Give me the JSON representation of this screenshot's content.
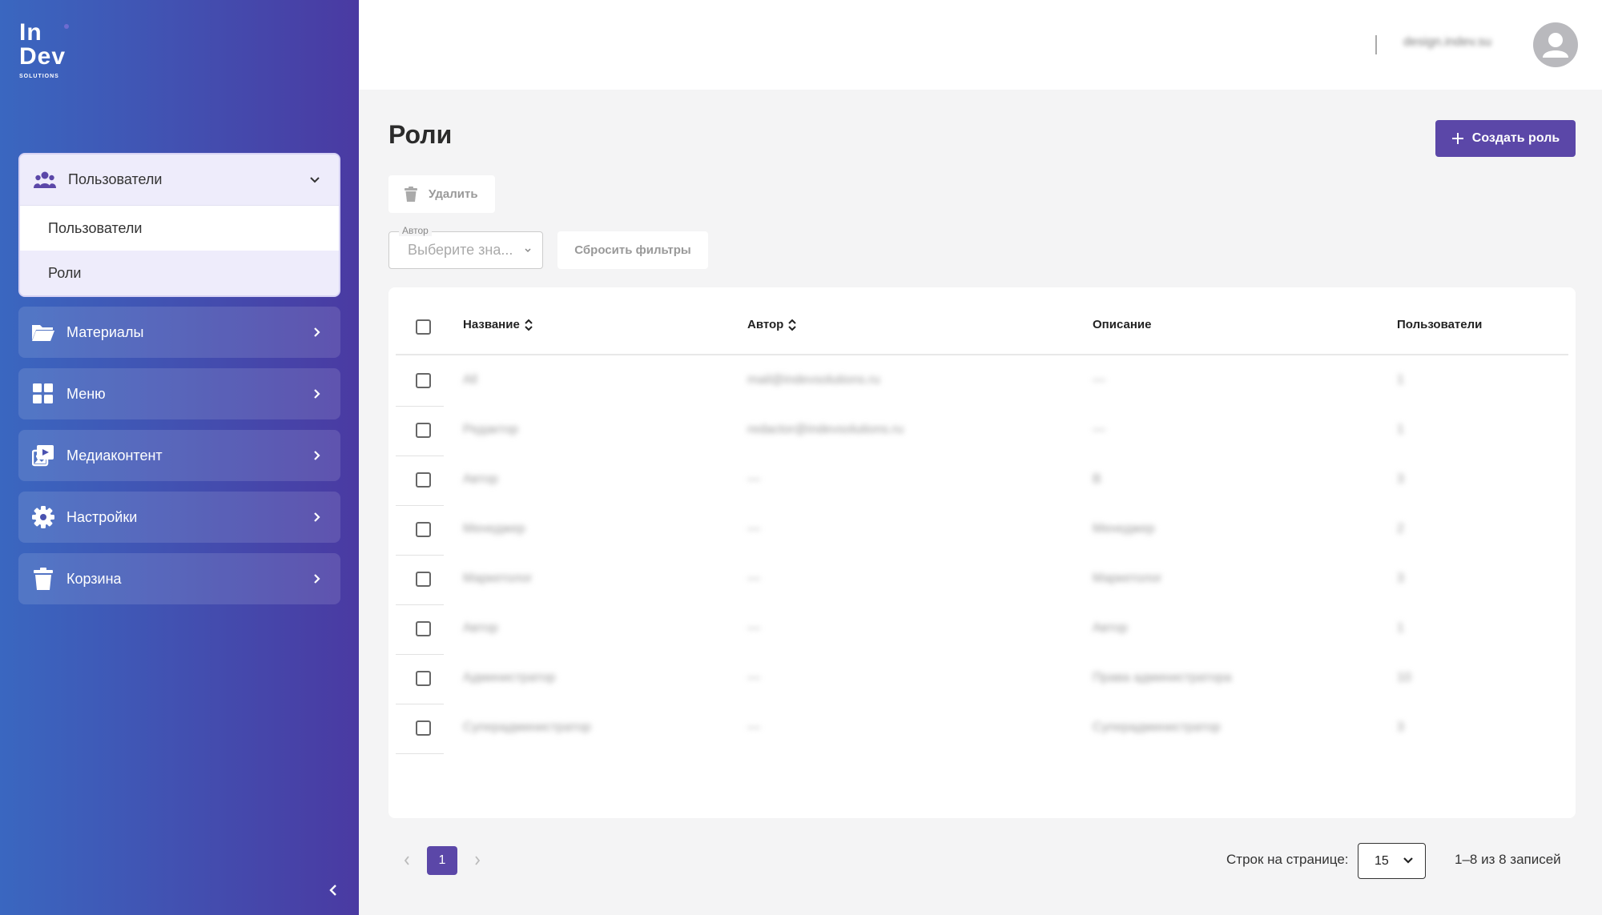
{
  "brand": {
    "line1": "In",
    "line2": "Dev",
    "line3": "SOLUTIONS"
  },
  "sidebar": {
    "open_group": {
      "label": "Пользователи",
      "icon": "users-icon",
      "children": [
        {
          "label": "Пользователи",
          "active": false
        },
        {
          "label": "Роли",
          "active": true
        }
      ]
    },
    "items": [
      {
        "label": "Материалы",
        "icon": "folder-icon"
      },
      {
        "label": "Меню",
        "icon": "grid-icon"
      },
      {
        "label": "Медиаконтент",
        "icon": "media-icon"
      },
      {
        "label": "Настройки",
        "icon": "gear-icon"
      },
      {
        "label": "Корзина",
        "icon": "trash-icon"
      }
    ]
  },
  "header": {
    "username": "design.indev.su"
  },
  "page": {
    "title": "Роли",
    "create_label": "Создать роль",
    "delete_label": "Удалить",
    "filter": {
      "label": "Автор",
      "placeholder": "Выберите зна..."
    },
    "reset_label": "Сбросить фильтры"
  },
  "table": {
    "columns": [
      "Название",
      "Автор",
      "Описание",
      "Пользователи"
    ],
    "rows": [
      [
        "All",
        "mail@indevsolutions.ru",
        "—",
        "1"
      ],
      [
        "Редактор",
        "redactor@indevsolutions.ru",
        "—",
        "1"
      ],
      [
        "Автор",
        "—",
        "В",
        "3"
      ],
      [
        "Менеджер",
        "—",
        "Менеджер",
        "2"
      ],
      [
        "Маркетолог",
        "—",
        "Маркетолог",
        "3"
      ],
      [
        "Автор",
        "—",
        "Автор",
        "1"
      ],
      [
        "Администратор",
        "—",
        "Права администратора",
        "10"
      ],
      [
        "Суперадминистратор",
        "—",
        "Суперадминистратор",
        "3"
      ]
    ]
  },
  "pagination": {
    "current_page": "1",
    "rows_label": "Строк на странице:",
    "rows_value": "15",
    "range": "1–8 из 8 записей"
  },
  "colors": {
    "accent": "#5b47a8",
    "sidebar_start": "#3a67c0",
    "sidebar_end": "#4a3aa2"
  }
}
